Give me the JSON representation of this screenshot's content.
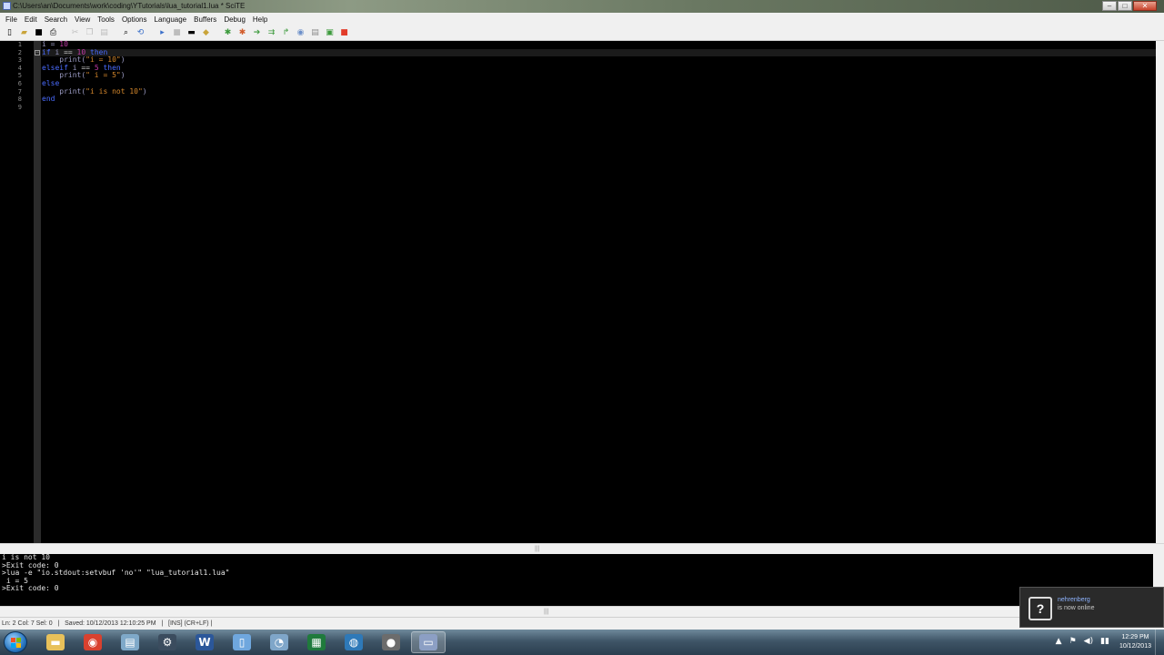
{
  "window": {
    "title": "C:\\Users\\an\\Documents\\work\\coding\\YTutorials\\lua_tutorial1.lua * SciTE",
    "min_label": "–",
    "max_label": "□",
    "close_label": "✕"
  },
  "menu": [
    "File",
    "Edit",
    "Search",
    "View",
    "Tools",
    "Options",
    "Language",
    "Buffers",
    "Debug",
    "Help"
  ],
  "editor": {
    "line_numbers": [
      "1",
      "2",
      "3",
      "4",
      "5",
      "6",
      "7",
      "8",
      "9"
    ],
    "current_line": 2,
    "code": [
      [
        {
          "t": "i = ",
          "c": "id"
        },
        {
          "t": "10",
          "c": "num"
        }
      ],
      [
        {
          "t": "if ",
          "c": "kw"
        },
        {
          "t": "i ",
          "c": "id"
        },
        {
          "t": "== ",
          "c": "op"
        },
        {
          "t": "10 ",
          "c": "num"
        },
        {
          "t": "then",
          "c": "kw"
        }
      ],
      [
        {
          "t": "    print(",
          "c": "id"
        },
        {
          "t": "\"i = 10\"",
          "c": "str"
        },
        {
          "t": ")",
          "c": "id"
        }
      ],
      [
        {
          "t": "elseif ",
          "c": "kw"
        },
        {
          "t": "i ",
          "c": "id"
        },
        {
          "t": "== ",
          "c": "op"
        },
        {
          "t": "5 ",
          "c": "num"
        },
        {
          "t": "then",
          "c": "kw"
        }
      ],
      [
        {
          "t": "    print(",
          "c": "id"
        },
        {
          "t": "\" i = 5\"",
          "c": "str"
        },
        {
          "t": ")",
          "c": "id"
        }
      ],
      [
        {
          "t": "else",
          "c": "kw"
        }
      ],
      [
        {
          "t": "    print(",
          "c": "id"
        },
        {
          "t": "\"i is not 10\"",
          "c": "str"
        },
        {
          "t": ")",
          "c": "id"
        }
      ],
      [
        {
          "t": "end",
          "c": "kw"
        }
      ],
      []
    ]
  },
  "output": {
    "lines": [
      "i is not 10",
      ">Exit code: 0",
      ">lua -e \"io.stdout:setvbuf 'no'\" \"lua_tutorial1.lua\"",
      " i = 5",
      ">Exit code: 0"
    ]
  },
  "status": {
    "text": "Ln: 2 Col: 7 Sel: 0   |   Saved: 10/12/2013 12:10:25 PM   |   [INS] (CR+LF) |"
  },
  "notification": {
    "name": "nehrenberg",
    "message": "is now online"
  },
  "taskbar": {
    "apps": [
      {
        "name": "explorer",
        "icon": "folder-icon",
        "color": "#e8c15a",
        "glyph": "▬"
      },
      {
        "name": "chrome",
        "icon": "chrome-icon",
        "color": "#d9412f",
        "glyph": "◉"
      },
      {
        "name": "notepad",
        "icon": "notepad-icon",
        "color": "#7fa9c9",
        "glyph": "▤"
      },
      {
        "name": "steam",
        "icon": "steam-icon",
        "color": "#3b4c5e",
        "glyph": "⚙"
      },
      {
        "name": "word",
        "icon": "word-icon",
        "color": "#2b579a",
        "glyph": "W"
      },
      {
        "name": "document",
        "icon": "document-icon",
        "color": "#6fa7de",
        "glyph": "▯"
      },
      {
        "name": "firefox",
        "icon": "firefox-icon",
        "color": "#7fa6c9",
        "glyph": "◔"
      },
      {
        "name": "excel",
        "icon": "excel-icon",
        "color": "#1f7a3c",
        "glyph": "▦"
      },
      {
        "name": "media",
        "icon": "media-icon",
        "color": "#2e79b8",
        "glyph": "◍"
      },
      {
        "name": "recorder",
        "icon": "recorder-icon",
        "color": "#6c6c6c",
        "glyph": "●"
      },
      {
        "name": "scite",
        "icon": "scite-icon",
        "color": "#8c9fc4",
        "glyph": "▭"
      }
    ],
    "tray_icons": [
      "▲",
      "⚑",
      "◀)",
      "▮▮"
    ],
    "time": "12:29 PM",
    "date": "10/12/2013"
  }
}
